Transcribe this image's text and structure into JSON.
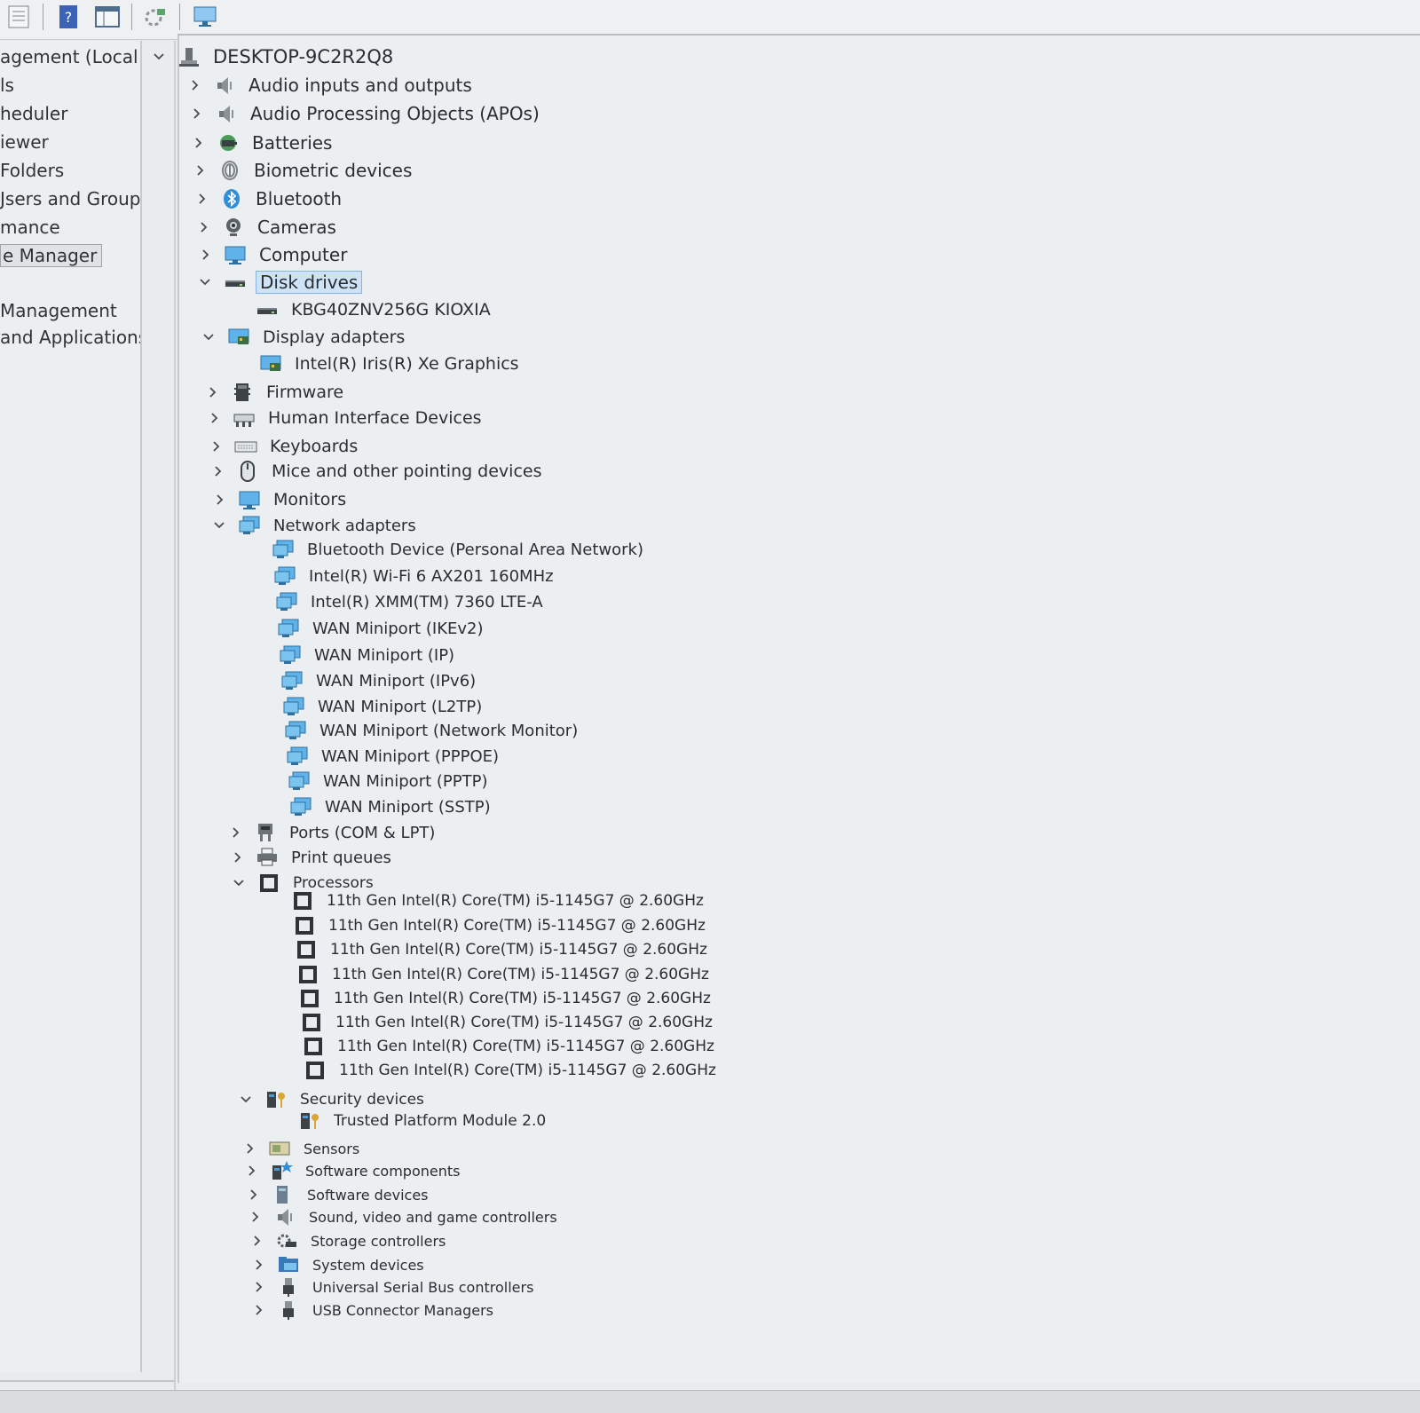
{
  "toolbar": {
    "buttons": [
      {
        "name": "properties-icon"
      },
      {
        "name": "help-icon"
      },
      {
        "name": "show-hide-console-tree-icon"
      },
      {
        "name": "update-driver-icon"
      },
      {
        "name": "scan-hardware-icon"
      }
    ]
  },
  "nav": {
    "items": [
      {
        "label": "agement (Local"
      },
      {
        "label": "ls"
      },
      {
        "label": "heduler"
      },
      {
        "label": "iewer"
      },
      {
        "label": " Folders"
      },
      {
        "label": "Jsers and Groups"
      },
      {
        "label": "mance"
      },
      {
        "label": "e Manager",
        "selected": true
      },
      {
        "label": "Management"
      },
      {
        "label": "and Applications"
      }
    ]
  },
  "tree": {
    "root": "DESKTOP-9C2R2Q8",
    "nodes": [
      {
        "label": "Audio inputs and outputs",
        "icon": "speaker-icon",
        "expander": "collapsed"
      },
      {
        "label": "Audio Processing Objects (APOs)",
        "icon": "speaker-icon",
        "expander": "collapsed"
      },
      {
        "label": "Batteries",
        "icon": "battery-icon",
        "expander": "collapsed"
      },
      {
        "label": "Biometric devices",
        "icon": "fingerprint-icon",
        "expander": "collapsed"
      },
      {
        "label": "Bluetooth",
        "icon": "bluetooth-icon",
        "expander": "collapsed"
      },
      {
        "label": "Cameras",
        "icon": "camera-icon",
        "expander": "collapsed"
      },
      {
        "label": "Computer",
        "icon": "monitor-icon",
        "expander": "collapsed"
      },
      {
        "label": "Disk drives",
        "icon": "disk-drive-icon",
        "expander": "expanded",
        "selected": true
      },
      {
        "label": "KBG40ZNV256G KIOXIA",
        "icon": "disk-drive-icon",
        "expander": "none"
      },
      {
        "label": "Display adapters",
        "icon": "display-adapter-icon",
        "expander": "expanded"
      },
      {
        "label": "Intel(R) Iris(R) Xe Graphics",
        "icon": "display-adapter-icon",
        "expander": "none"
      },
      {
        "label": "Firmware",
        "icon": "firmware-chip-icon",
        "expander": "collapsed"
      },
      {
        "label": "Human Interface Devices",
        "icon": "hid-icon",
        "expander": "collapsed"
      },
      {
        "label": "Keyboards",
        "icon": "keyboard-icon",
        "expander": "collapsed"
      },
      {
        "label": "Mice and other pointing devices",
        "icon": "mouse-icon",
        "expander": "collapsed"
      },
      {
        "label": "Monitors",
        "icon": "monitor-icon",
        "expander": "collapsed"
      },
      {
        "label": "Network adapters",
        "icon": "network-adapter-icon",
        "expander": "expanded"
      },
      {
        "label": "Bluetooth Device (Personal Area Network)",
        "icon": "network-adapter-icon",
        "expander": "none"
      },
      {
        "label": "Intel(R) Wi-Fi 6 AX201 160MHz",
        "icon": "network-adapter-icon",
        "expander": "none"
      },
      {
        "label": "Intel(R) XMM(TM) 7360 LTE-A",
        "icon": "network-adapter-icon",
        "expander": "none"
      },
      {
        "label": "WAN Miniport (IKEv2)",
        "icon": "network-adapter-icon",
        "expander": "none"
      },
      {
        "label": "WAN Miniport (IP)",
        "icon": "network-adapter-icon",
        "expander": "none"
      },
      {
        "label": "WAN Miniport (IPv6)",
        "icon": "network-adapter-icon",
        "expander": "none"
      },
      {
        "label": "WAN Miniport (L2TP)",
        "icon": "network-adapter-icon",
        "expander": "none"
      },
      {
        "label": "WAN Miniport (Network Monitor)",
        "icon": "network-adapter-icon",
        "expander": "none"
      },
      {
        "label": "WAN Miniport (PPPOE)",
        "icon": "network-adapter-icon",
        "expander": "none"
      },
      {
        "label": "WAN Miniport (PPTP)",
        "icon": "network-adapter-icon",
        "expander": "none"
      },
      {
        "label": "WAN Miniport (SSTP)",
        "icon": "network-adapter-icon",
        "expander": "none"
      },
      {
        "label": "Ports (COM & LPT)",
        "icon": "port-icon",
        "expander": "collapsed"
      },
      {
        "label": "Print queues",
        "icon": "printer-icon",
        "expander": "collapsed"
      },
      {
        "label": "Processors",
        "icon": "processor-icon",
        "expander": "expanded"
      },
      {
        "label": "11th Gen Intel(R) Core(TM) i5-1145G7 @ 2.60GHz",
        "icon": "processor-icon",
        "expander": "none"
      },
      {
        "label": "11th Gen Intel(R) Core(TM) i5-1145G7 @ 2.60GHz",
        "icon": "processor-icon",
        "expander": "none"
      },
      {
        "label": "11th Gen Intel(R) Core(TM) i5-1145G7 @ 2.60GHz",
        "icon": "processor-icon",
        "expander": "none"
      },
      {
        "label": "11th Gen Intel(R) Core(TM) i5-1145G7 @ 2.60GHz",
        "icon": "processor-icon",
        "expander": "none"
      },
      {
        "label": "11th Gen Intel(R) Core(TM) i5-1145G7 @ 2.60GHz",
        "icon": "processor-icon",
        "expander": "none"
      },
      {
        "label": "11th Gen Intel(R) Core(TM) i5-1145G7 @ 2.60GHz",
        "icon": "processor-icon",
        "expander": "none"
      },
      {
        "label": "11th Gen Intel(R) Core(TM) i5-1145G7 @ 2.60GHz",
        "icon": "processor-icon",
        "expander": "none"
      },
      {
        "label": "11th Gen Intel(R) Core(TM) i5-1145G7 @ 2.60GHz",
        "icon": "processor-icon",
        "expander": "none"
      },
      {
        "label": "Security devices",
        "icon": "security-key-icon",
        "expander": "expanded"
      },
      {
        "label": "Trusted Platform Module 2.0",
        "icon": "security-key-icon",
        "expander": "none"
      },
      {
        "label": "Sensors",
        "icon": "sensor-icon",
        "expander": "collapsed"
      },
      {
        "label": "Software components",
        "icon": "software-component-icon",
        "expander": "collapsed"
      },
      {
        "label": "Software devices",
        "icon": "software-device-icon",
        "expander": "collapsed"
      },
      {
        "label": "Sound, video and game controllers",
        "icon": "speaker-icon",
        "expander": "collapsed"
      },
      {
        "label": "Storage controllers",
        "icon": "storage-controller-icon",
        "expander": "collapsed"
      },
      {
        "label": "System devices",
        "icon": "system-folder-icon",
        "expander": "collapsed"
      },
      {
        "label": "Universal Serial Bus controllers",
        "icon": "usb-icon",
        "expander": "collapsed"
      },
      {
        "label": "USB Connector Managers",
        "icon": "usb-icon",
        "expander": "collapsed"
      }
    ]
  },
  "colors": {
    "selection_fill": "#cfe3f7",
    "selection_border": "#84b5e6",
    "icon_blue": "#2f8fd6",
    "text": "#2a2e33"
  }
}
